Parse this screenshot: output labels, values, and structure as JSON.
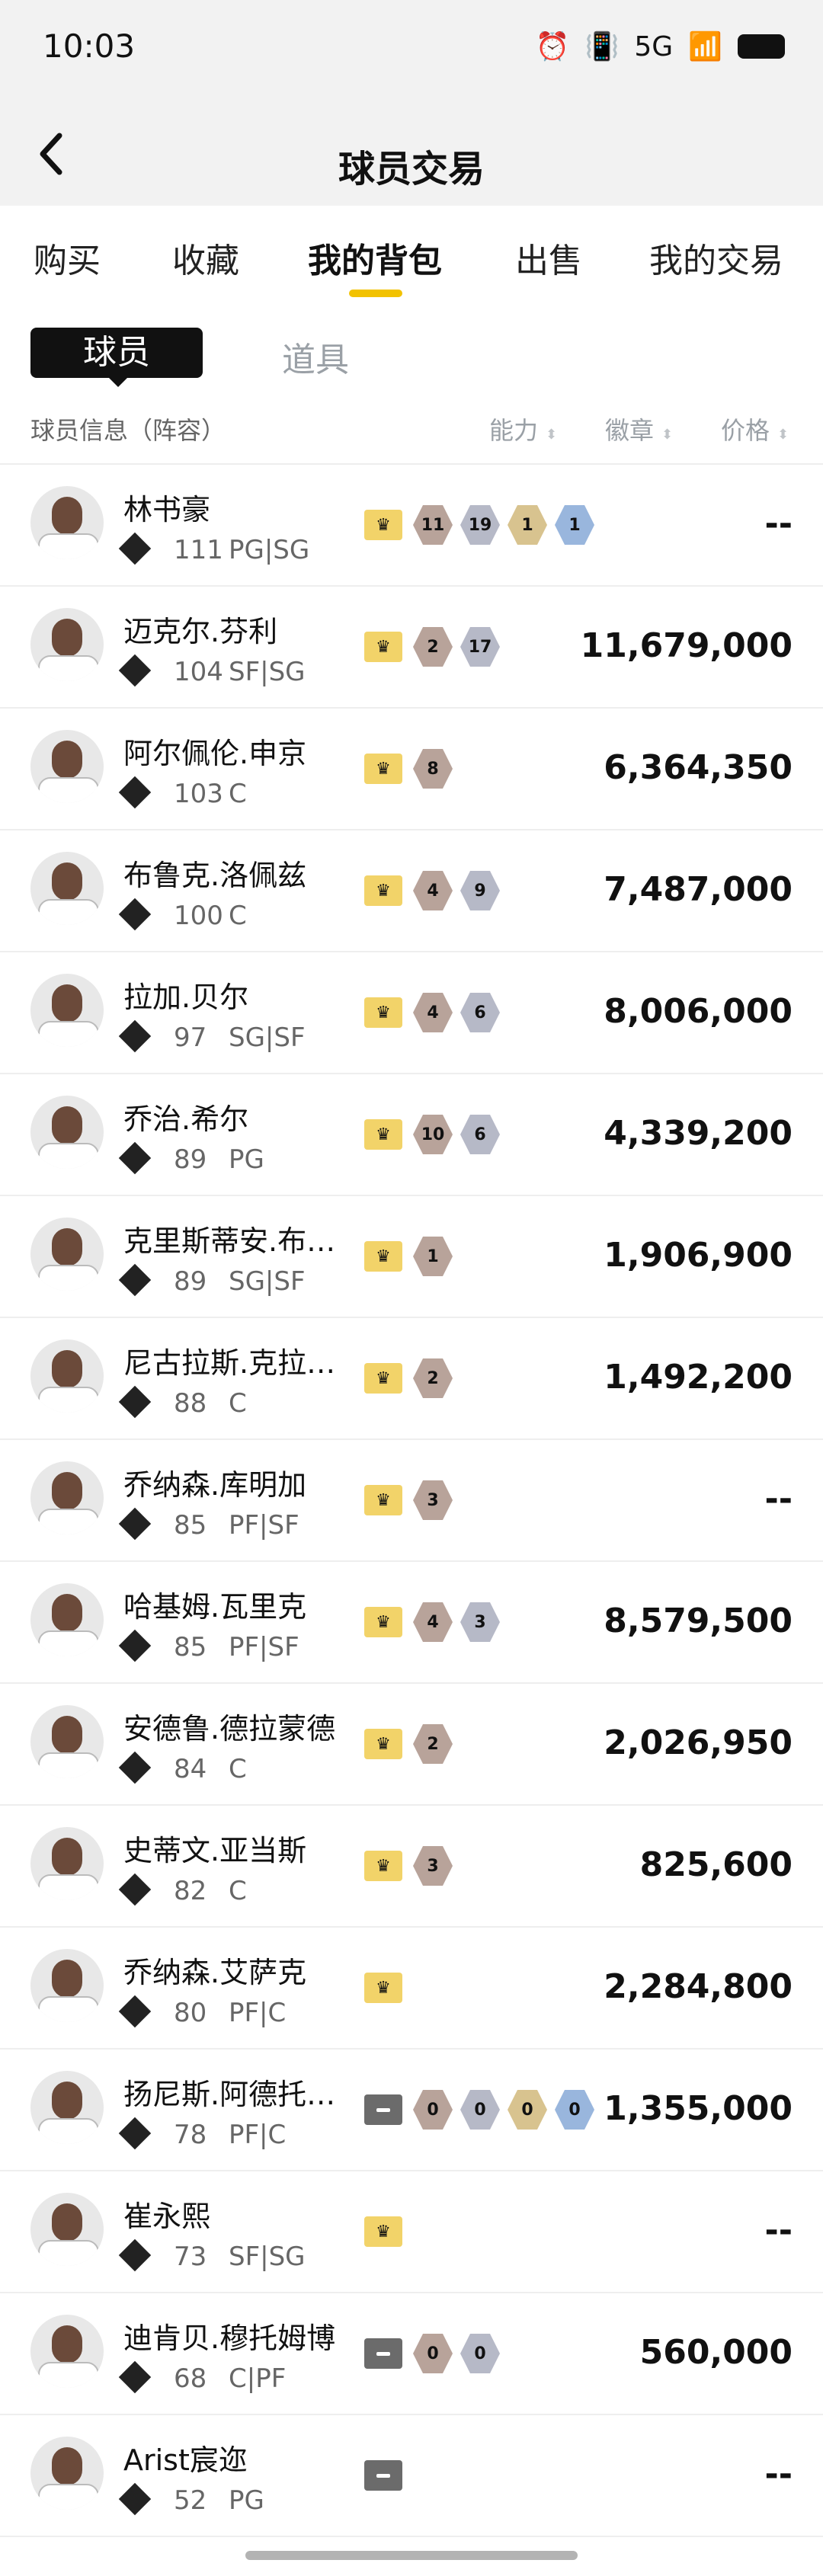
{
  "status": {
    "time": "10:03",
    "network": "5G"
  },
  "nav": {
    "title": "球员交易"
  },
  "tabs": [
    "购买",
    "收藏",
    "我的背包",
    "出售",
    "我的交易"
  ],
  "subtabs": {
    "active": "球员",
    "inactive": "道具"
  },
  "table_header": {
    "info": "球员信息（阵容）",
    "ability": "能力",
    "badge": "徽章",
    "price": "价格"
  },
  "players": [
    {
      "name": "林书豪",
      "ability": "111",
      "pos": "PG|SG",
      "tier": "gold",
      "badges": [
        "11",
        "19",
        "1",
        "1"
      ],
      "badge_colors": [
        "bronze",
        "silver",
        "gold",
        "hof"
      ],
      "price": "--"
    },
    {
      "name": "迈克尔.芬利",
      "ability": "104",
      "pos": "SF|SG",
      "tier": "gold",
      "badges": [
        "2",
        "17"
      ],
      "badge_colors": [
        "bronze",
        "silver"
      ],
      "price": "11,679,000"
    },
    {
      "name": "阿尔佩伦.申京",
      "ability": "103",
      "pos": "C",
      "tier": "gold",
      "badges": [
        "8"
      ],
      "badge_colors": [
        "bronze"
      ],
      "price": "6,364,350"
    },
    {
      "name": "布鲁克.洛佩兹",
      "ability": "100",
      "pos": "C",
      "tier": "gold",
      "badges": [
        "4",
        "9"
      ],
      "badge_colors": [
        "bronze",
        "silver"
      ],
      "price": "7,487,000"
    },
    {
      "name": "拉加.贝尔",
      "ability": "97",
      "pos": "SG|SF",
      "tier": "gold",
      "badges": [
        "4",
        "6"
      ],
      "badge_colors": [
        "bronze",
        "silver"
      ],
      "price": "8,006,000"
    },
    {
      "name": "乔治.希尔",
      "ability": "89",
      "pos": "PG",
      "tier": "gold",
      "badges": [
        "10",
        "6"
      ],
      "badge_colors": [
        "bronze",
        "silver"
      ],
      "price": "4,339,200"
    },
    {
      "name": "克里斯蒂安.布…",
      "ability": "89",
      "pos": "SG|SF",
      "tier": "gold",
      "badges": [
        "1"
      ],
      "badge_colors": [
        "bronze"
      ],
      "price": "1,906,900"
    },
    {
      "name": "尼古拉斯.克拉…",
      "ability": "88",
      "pos": "C",
      "tier": "gold",
      "badges": [
        "2"
      ],
      "badge_colors": [
        "bronze"
      ],
      "price": "1,492,200"
    },
    {
      "name": "乔纳森.库明加",
      "ability": "85",
      "pos": "PF|SF",
      "tier": "gold",
      "badges": [
        "3"
      ],
      "badge_colors": [
        "bronze"
      ],
      "price": "--"
    },
    {
      "name": "哈基姆.瓦里克",
      "ability": "85",
      "pos": "PF|SF",
      "tier": "gold",
      "badges": [
        "4",
        "3"
      ],
      "badge_colors": [
        "bronze",
        "silver"
      ],
      "price": "8,579,500"
    },
    {
      "name": "安德鲁.德拉蒙德",
      "ability": "84",
      "pos": "C",
      "tier": "gold",
      "badges": [
        "2"
      ],
      "badge_colors": [
        "bronze"
      ],
      "price": "2,026,950"
    },
    {
      "name": "史蒂文.亚当斯",
      "ability": "82",
      "pos": "C",
      "tier": "gold",
      "badges": [
        "3"
      ],
      "badge_colors": [
        "bronze"
      ],
      "price": "825,600"
    },
    {
      "name": "乔纳森.艾萨克",
      "ability": "80",
      "pos": "PF|C",
      "tier": "gold",
      "badges": [],
      "badge_colors": [],
      "price": "2,284,800"
    },
    {
      "name": "扬尼斯.阿德托…",
      "ability": "78",
      "pos": "PF|C",
      "tier": "grey",
      "badges": [
        "0",
        "0",
        "0",
        "0"
      ],
      "badge_colors": [
        "bronze",
        "silver",
        "gold",
        "hof"
      ],
      "price": "1,355,000"
    },
    {
      "name": "崔永熙",
      "ability": "73",
      "pos": "SF|SG",
      "tier": "gold",
      "badges": [],
      "badge_colors": [],
      "price": "--"
    },
    {
      "name": "迪肯贝.穆托姆博",
      "ability": "68",
      "pos": "C|PF",
      "tier": "grey",
      "badges": [
        "0",
        "0"
      ],
      "badge_colors": [
        "bronze",
        "silver"
      ],
      "price": "560,000"
    },
    {
      "name": "Arist宸迩",
      "ability": "52",
      "pos": "PG",
      "tier": "grey",
      "badges": [],
      "badge_colors": [],
      "price": "--"
    }
  ]
}
